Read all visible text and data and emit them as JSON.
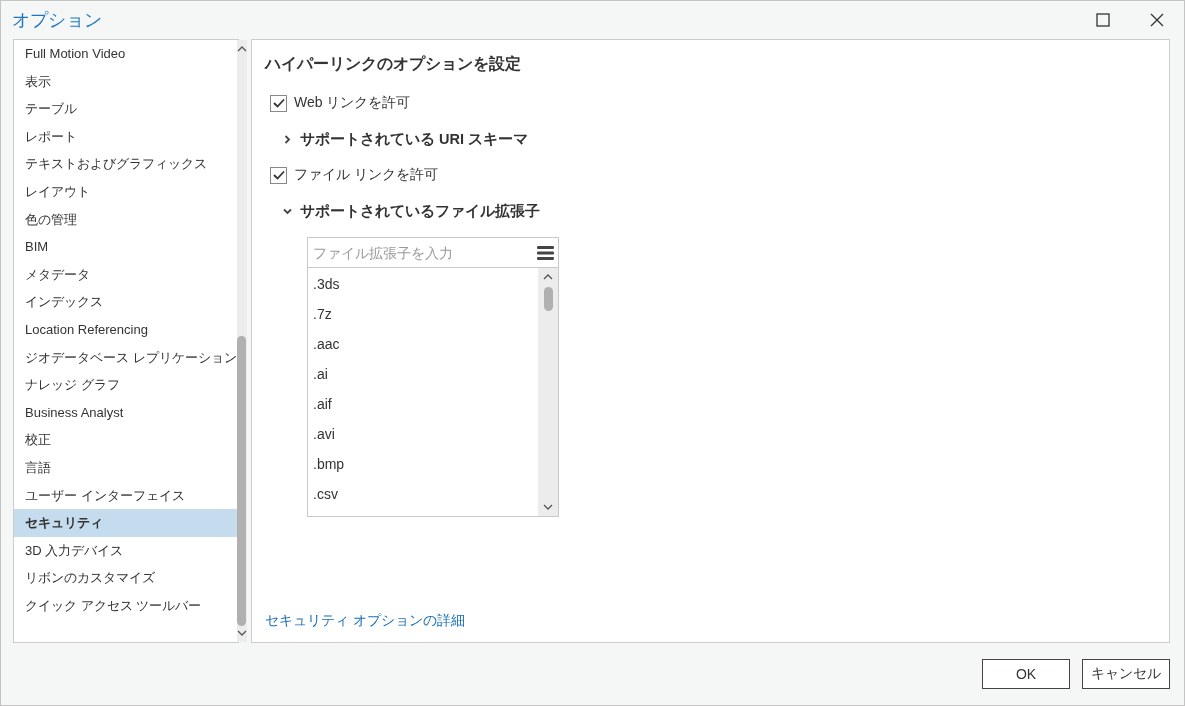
{
  "window": {
    "title": "オプション"
  },
  "sidebar": {
    "items": [
      {
        "label": "Full Motion Video",
        "selected": false
      },
      {
        "label": "表示",
        "selected": false
      },
      {
        "label": "テーブル",
        "selected": false
      },
      {
        "label": "レポート",
        "selected": false
      },
      {
        "label": "テキストおよびグラフィックス",
        "selected": false
      },
      {
        "label": "レイアウト",
        "selected": false
      },
      {
        "label": "色の管理",
        "selected": false
      },
      {
        "label": "BIM",
        "selected": false
      },
      {
        "label": "メタデータ",
        "selected": false
      },
      {
        "label": "インデックス",
        "selected": false
      },
      {
        "label": "Location Referencing",
        "selected": false
      },
      {
        "label": "ジオデータベース レプリケーション",
        "selected": false
      },
      {
        "label": "ナレッジ グラフ",
        "selected": false
      },
      {
        "label": "Business Analyst",
        "selected": false
      },
      {
        "label": "校正",
        "selected": false
      },
      {
        "label": "言語",
        "selected": false
      },
      {
        "label": "ユーザー インターフェイス",
        "selected": false
      },
      {
        "label": "セキュリティ",
        "selected": true
      },
      {
        "label": "3D 入力デバイス",
        "selected": false
      },
      {
        "label": "リボンのカスタマイズ",
        "selected": false
      },
      {
        "label": "クイック アクセス ツールバー",
        "selected": false
      }
    ]
  },
  "content": {
    "heading": "ハイパーリンクのオプションを設定",
    "options": [
      {
        "kind": "checkbox",
        "label": "Web リンクを許可",
        "checked": true
      },
      {
        "kind": "expander",
        "label": "サポートされている URI スキーマ",
        "expanded": false
      },
      {
        "kind": "checkbox",
        "label": "ファイル リンクを許可",
        "checked": true
      },
      {
        "kind": "expander",
        "label": "サポートされているファイル拡張子",
        "expanded": true
      }
    ],
    "extensions": {
      "placeholder": "ファイル拡張子を入力",
      "items": [
        ".3ds",
        ".7z",
        ".aac",
        ".ai",
        ".aif",
        ".avi",
        ".bmp",
        ".csv"
      ]
    },
    "link": "セキュリティ オプションの詳細"
  },
  "buttons": [
    "OK",
    "キャンセル"
  ]
}
